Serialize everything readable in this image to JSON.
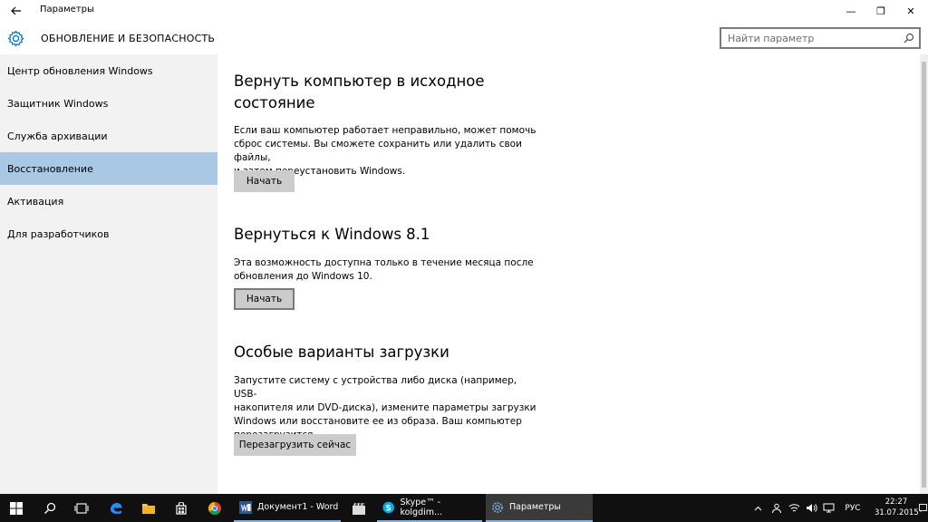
{
  "window": {
    "title": "Параметры",
    "back_icon": "back-arrow-icon",
    "minimize_glyph": "—",
    "maximize_glyph": "❐",
    "close_glyph": "✕"
  },
  "header": {
    "section_title": "ОБНОВЛЕНИЕ И БЕЗОПАСНОСТЬ",
    "search_placeholder": "Найти параметр"
  },
  "sidebar": {
    "items": [
      {
        "label": "Центр обновления Windows",
        "active": false
      },
      {
        "label": "Защитник Windows",
        "active": false
      },
      {
        "label": "Служба архивации",
        "active": false
      },
      {
        "label": "Восстановление",
        "active": true
      },
      {
        "label": "Активация",
        "active": false
      },
      {
        "label": "Для разработчиков",
        "active": false
      }
    ]
  },
  "main": {
    "reset": {
      "title_line1": "Вернуть компьютер в исходное",
      "title_line2": "состояние",
      "description_lines": [
        "Если ваш компьютер работает неправильно, может помочь",
        "сброс системы. Вы сможете сохранить или удалить свои файлы,",
        "и затем переустановить Windows."
      ],
      "button": "Начать"
    },
    "rollback": {
      "title": "Вернуться к Windows 8.1",
      "description_lines": [
        "Эта возможность доступна только в течение месяца после",
        "обновления до Windows 10."
      ],
      "button": "Начать"
    },
    "advanced": {
      "title": "Особые варианты загрузки",
      "description_lines": [
        "Запустите систему с устройства либо диска (например, USB-",
        "накопителя или DVD-диска), измените параметры загрузки",
        "Windows или восстановите ее из образа. Ваш компьютер",
        "перезагрузится."
      ],
      "button": "Перезагрузить сейчас"
    }
  },
  "taskbar": {
    "apps": [
      {
        "label": "Документ1 - Word",
        "icon": "word-icon"
      },
      {
        "label": "Skype™ - kolgdim...",
        "icon": "skype-icon"
      },
      {
        "label": "Параметры",
        "icon": "settings-icon"
      }
    ],
    "language": "РУС",
    "time": "22:27",
    "date": "31.07.2015"
  },
  "colors": {
    "accent": "#0078d7",
    "active_nav": "#a8c8e3",
    "sidebar_bg": "#f2f2f2",
    "button_bg": "#cccccc",
    "taskbar_bg": "#101010"
  }
}
